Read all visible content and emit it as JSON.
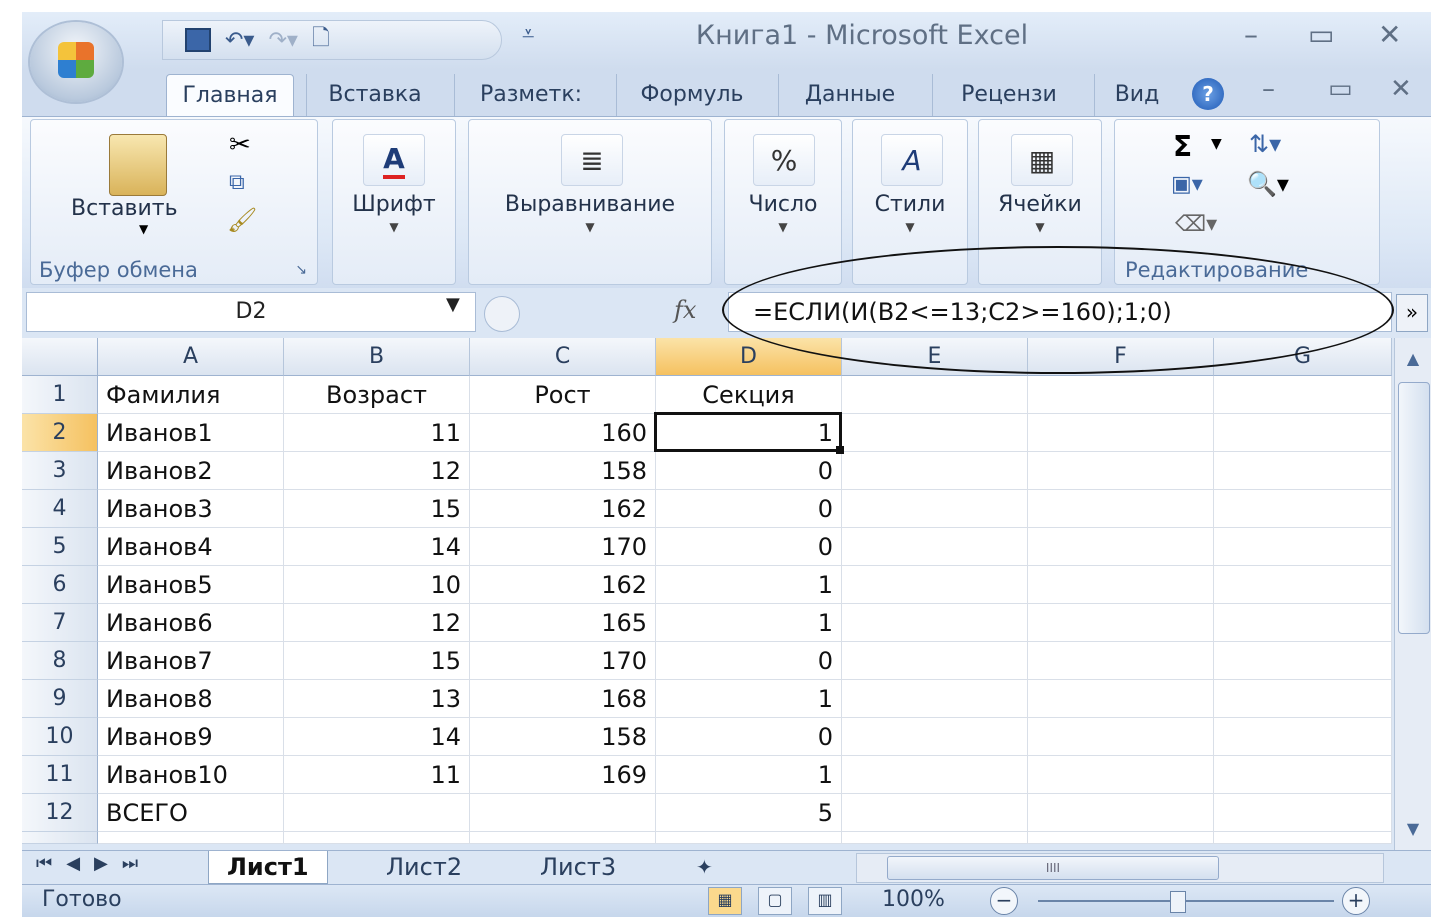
{
  "window": {
    "title": "Книга1 - Microsoft Excel"
  },
  "ribbon": {
    "tabs": [
      "Главная",
      "Вставка",
      "Разметк:",
      "Формуль",
      "Данные",
      "Рецензи",
      "Вид"
    ],
    "active_tab": "Главная",
    "groups": {
      "clipboard": {
        "button": "Вставить",
        "label": "Буфер обмена"
      },
      "font": {
        "button": "Шрифт"
      },
      "alignment": {
        "button": "Выравнивание"
      },
      "number": {
        "button": "Число",
        "icon_text": "%"
      },
      "styles": {
        "button": "Стили"
      },
      "cells": {
        "button": "Ячейки"
      },
      "editing": {
        "label": "Редактирование",
        "sum_icon": "Σ"
      }
    }
  },
  "formula_bar": {
    "name_box": "D2",
    "fx": "fx",
    "formula": "=ЕСЛИ(И(B2<=13;C2>=160);1;0)"
  },
  "sheet": {
    "columns": [
      "A",
      "B",
      "C",
      "D",
      "E",
      "F",
      "G"
    ],
    "selected_column": "D",
    "selected_row": 2,
    "rows": [
      {
        "n": "1",
        "a": "Фамилия",
        "b": "Возраст",
        "c": "Рост",
        "d": "Секция"
      },
      {
        "n": "2",
        "a": "Иванов1",
        "b": "11",
        "c": "160",
        "d": "1"
      },
      {
        "n": "3",
        "a": "Иванов2",
        "b": "12",
        "c": "158",
        "d": "0"
      },
      {
        "n": "4",
        "a": "Иванов3",
        "b": "15",
        "c": "162",
        "d": "0"
      },
      {
        "n": "5",
        "a": "Иванов4",
        "b": "14",
        "c": "170",
        "d": "0"
      },
      {
        "n": "6",
        "a": "Иванов5",
        "b": "10",
        "c": "162",
        "d": "1"
      },
      {
        "n": "7",
        "a": "Иванов6",
        "b": "12",
        "c": "165",
        "d": "1"
      },
      {
        "n": "8",
        "a": "Иванов7",
        "b": "15",
        "c": "170",
        "d": "0"
      },
      {
        "n": "9",
        "a": "Иванов8",
        "b": "13",
        "c": "168",
        "d": "1"
      },
      {
        "n": "10",
        "a": "Иванов9",
        "b": "14",
        "c": "158",
        "d": "0"
      },
      {
        "n": "11",
        "a": "Иванов10",
        "b": "11",
        "c": "169",
        "d": "1"
      },
      {
        "n": "12",
        "a": "ВСЕГО",
        "b": "",
        "c": "",
        "d": "5"
      }
    ]
  },
  "sheet_tabs": [
    "Лист1",
    "Лист2",
    "Лист3"
  ],
  "status": {
    "text": "Готово",
    "zoom": "100%"
  },
  "colors": {
    "accent_selection": "#f5c160",
    "ribbon_blue": "#dbe6f4"
  }
}
